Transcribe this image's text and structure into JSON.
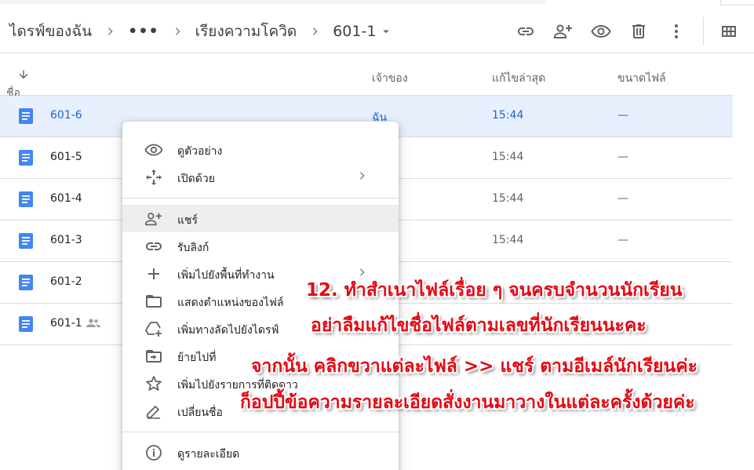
{
  "breadcrumb": {
    "root": "ไดรฟ์ของฉัน",
    "more": "•••",
    "folder": "เรียงความโควิด",
    "current": "601-1"
  },
  "toolbar": {
    "icons": [
      "link-icon",
      "add-person-icon",
      "preview-eye-icon",
      "trash-icon",
      "more-vert-icon",
      "grid-view-icon"
    ]
  },
  "columns": {
    "name": "ชื่อ",
    "owner": "เจ้าของ",
    "modified": "แก้ไขล่าสุด",
    "size": "ขนาดไฟล์"
  },
  "files": [
    {
      "name": "601-6",
      "owner": "ฉัน",
      "modified": "15:44",
      "size": "—",
      "selected": true
    },
    {
      "name": "601-5",
      "owner": "",
      "modified": "15:44",
      "size": "—"
    },
    {
      "name": "601-4",
      "owner": "",
      "modified": "15:44",
      "size": "—"
    },
    {
      "name": "601-3",
      "owner": "",
      "modified": "15:44",
      "size": "—"
    },
    {
      "name": "601-2",
      "owner": "",
      "modified": "",
      "size": ""
    },
    {
      "name": "601-1",
      "owner": "",
      "modified": "",
      "size": "",
      "shared": true
    }
  ],
  "context_menu": {
    "items": [
      {
        "label": "ดูตัวอย่าง",
        "icon": "eye-icon"
      },
      {
        "label": "เปิดด้วย",
        "icon": "move-arrows-icon"
      },
      {
        "label": "แชร์",
        "icon": "add-person-icon"
      },
      {
        "label": "รับลิงก์",
        "icon": "link-icon"
      },
      {
        "label": "เพิ่มไปยังพื้นที่ทำงาน",
        "icon": "plus-icon"
      },
      {
        "label": "แสดงตำแหน่งของไฟล์",
        "icon": "folder-icon"
      },
      {
        "label": "เพิ่มทางลัดไปยังไดรฟ์",
        "icon": "add-shortcut-icon"
      },
      {
        "label": "ย้ายไปที่",
        "icon": "move-to-icon"
      },
      {
        "label": "เพิ่มไปยังรายการที่ติดดาว",
        "icon": "star-icon"
      },
      {
        "label": "เปลี่ยนชื่อ",
        "icon": "pencil-icon"
      },
      {
        "label": "ดูรายละเอียด",
        "icon": "info-icon"
      }
    ]
  },
  "overlay_text": {
    "line1": "12. ทำสำเนาไฟล์เรื่อย ๆ จนครบจำนวนนักเรียน",
    "line2": "อย่าลืมแก้ไขชื่อไฟล์ตามเลขที่นักเรียนนะคะ",
    "line3": "จากนั้น คลิกขวาแต่ละไฟล์ >> แชร์ ตามอีเมล์นักเรียนค่ะ",
    "line4": "ก็อปปี้ข้อความรายละเอียดสั่งงานมาวางในแต่ละครั้งด้วยค่ะ"
  },
  "colors": {
    "accent": "#1967d2",
    "doc_blue": "#4285f4",
    "selected_row": "#e8f0fe",
    "overlay_red": "#e50914"
  }
}
